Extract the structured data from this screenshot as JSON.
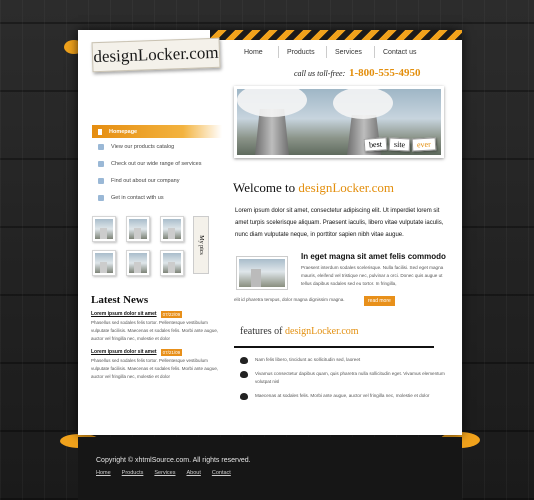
{
  "logo": {
    "text": "designLocker.com"
  },
  "nav": {
    "items": [
      "Home",
      "Products",
      "Services",
      "Contact us"
    ]
  },
  "tollfree": {
    "label": "call us toll-free:",
    "number": "1-800-555-4950"
  },
  "hero": {
    "tags": [
      "best",
      "site",
      "ever"
    ]
  },
  "sidebar": {
    "items": [
      "Homepage",
      "View our products catalog",
      "Check out our wide range of services",
      "Find out about our company",
      "Get in contact with us"
    ],
    "gallery_label": "My pics"
  },
  "news": {
    "title": "Latest News",
    "items": [
      {
        "headline": "Lorem ipsum dolor sit amet",
        "date": "07/22/09",
        "body": "Phasellus sed sodales felis tortor. Pellentesque vestibulum vulputate facilisis. Maecenas et sodales felis. Morbi ante augue, auctor vel fringilla nec, molestie et dolor"
      },
      {
        "headline": "Lorem ipsum dolor sit amet",
        "date": "07/21/09",
        "body": "Phasellus sed sodales felis tortor. Pellentesque vestibulum vulputate facilisis. Maecenas et sodales felis. Morbi ante augue, auctor vel fringilla nec, molestie et dolor"
      }
    ]
  },
  "main": {
    "welcome_prefix": "Welcome to ",
    "welcome_brand": "designLocker.com",
    "intro": "Lorem ipsum dolor sit amet, consectetur adipiscing elit. Ut imperdiet lorem sit amet turpis scelerisque aliquam. Praesent iaculis, libero vitae vulputate iaculis, nunc diam vulputate neque, in porttitor sapien nibh vitae augue.",
    "feature_title": "In eget magna sit amet felis commodo",
    "feature_text": "Praesent interdum sodales scelerisque. Nulla facilisi. Sed eget magna mauris, eleifend vel tristique nec, pulvinar a orci. Donec quis augue ut tellus dapibus sodales sed eu tortor. In fringilla,",
    "feature_text2": "elit id pharetra tempus, dolor magna dignissim magna.",
    "read_more": "read more",
    "features_prefix": "features of ",
    "features_brand": "designLocker.com",
    "features": [
      "Nam felis libero, tincidunt ac sollicitudin sed, laoreet",
      "Vivamus consectetur dapibus quam, quis pharetra nulla sollicitudin eget. Vivamus elementum volutpat nisl",
      "Maecenas at sodales felis. Morbi ante augue, auctor vel fringilla nec, molestie et dolor"
    ]
  },
  "footer": {
    "copyright": "Copyright © xhtmlSource.com.  All rights reserved.",
    "links": [
      "Home",
      "Products",
      "Services",
      "About",
      "Contact"
    ]
  },
  "colors": {
    "accent": "#e8901a",
    "background": "#1f1f1f",
    "page": "#ffffff"
  }
}
